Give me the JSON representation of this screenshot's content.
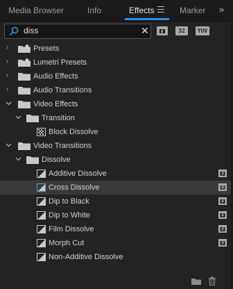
{
  "tabs": [
    {
      "label": "Media Browser",
      "active": false
    },
    {
      "label": "Info",
      "active": false
    },
    {
      "label": "Effects",
      "active": true
    },
    {
      "label": "Marker",
      "active": false
    }
  ],
  "search": {
    "value": "diss",
    "placeholder": ""
  },
  "filters": [
    "32",
    "YUV"
  ],
  "tree": {
    "presets": "Presets",
    "lumetri_presets": "Lumetri Presets",
    "audio_effects": "Audio Effects",
    "audio_transitions": "Audio Transitions",
    "video_effects": "Video Effects",
    "transition_folder": "Transition",
    "block_dissolve": "Block Dissolve",
    "video_transitions": "Video Transitions",
    "dissolve_folder": "Dissolve",
    "dissolves": [
      {
        "label": "Additive Dissolve",
        "accelerated": true,
        "selected": false
      },
      {
        "label": "Cross Dissolve",
        "accelerated": true,
        "selected": true
      },
      {
        "label": "Dip to Black",
        "accelerated": true,
        "selected": false
      },
      {
        "label": "Dip to White",
        "accelerated": true,
        "selected": false
      },
      {
        "label": "Film Dissolve",
        "accelerated": true,
        "selected": false
      },
      {
        "label": "Morph Cut",
        "accelerated": true,
        "selected": false
      },
      {
        "label": "Non-Additive Dissolve",
        "accelerated": false,
        "selected": false
      }
    ]
  },
  "colors": {
    "accent": "#2d8ceb",
    "selection": "#3a3a3a",
    "background": "#232323"
  }
}
